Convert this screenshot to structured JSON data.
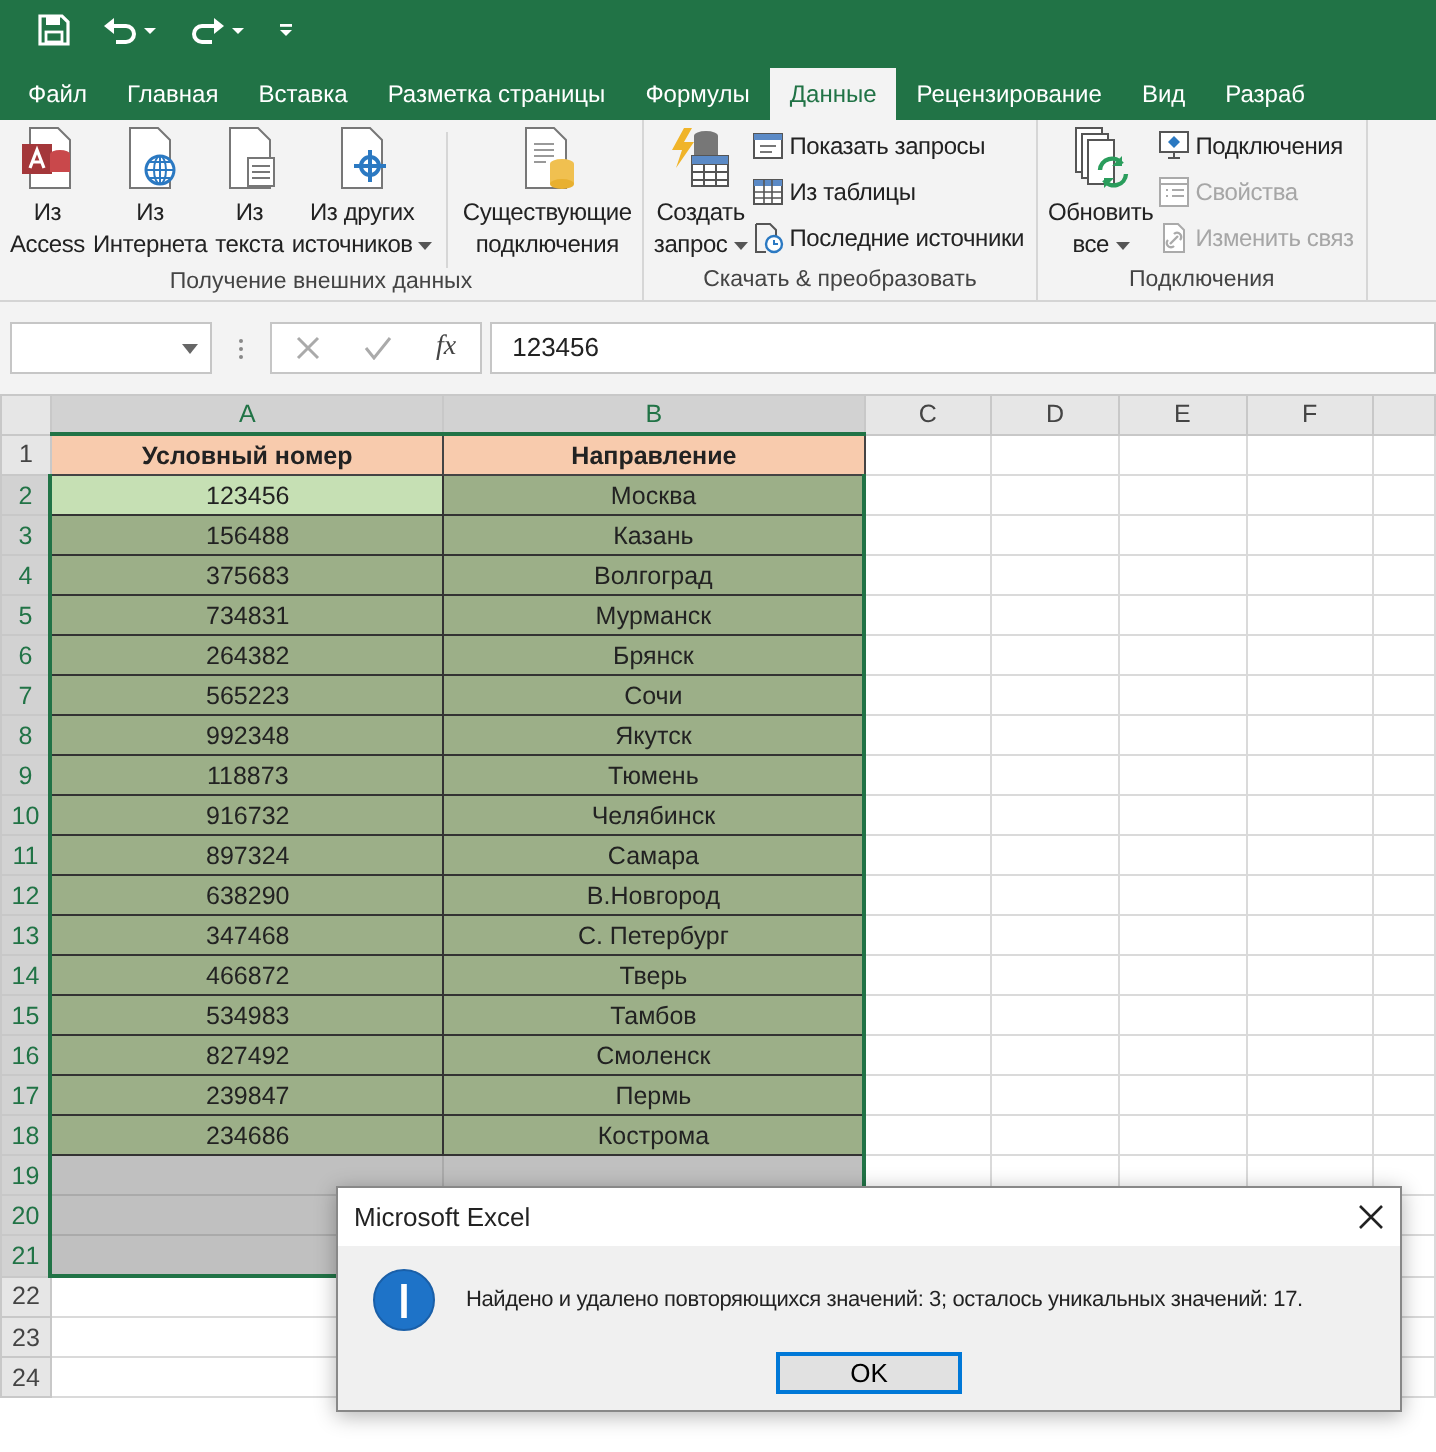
{
  "tabs": [
    {
      "label": "Файл",
      "selected": false
    },
    {
      "label": "Главная",
      "selected": false
    },
    {
      "label": "Вставка",
      "selected": false
    },
    {
      "label": "Разметка страницы",
      "selected": false
    },
    {
      "label": "Формулы",
      "selected": false
    },
    {
      "label": "Данные",
      "selected": true
    },
    {
      "label": "Рецензирование",
      "selected": false
    },
    {
      "label": "Вид",
      "selected": false
    },
    {
      "label": "Разраб",
      "selected": false
    }
  ],
  "ribbon": [
    {
      "label": "Получение внешних данных",
      "items": [
        {
          "kind": "large",
          "lines": [
            "Из",
            "Access"
          ],
          "dropdown": false,
          "disabled": false
        },
        {
          "kind": "large",
          "lines": [
            "Из",
            "Интернета"
          ],
          "dropdown": false,
          "disabled": false
        },
        {
          "kind": "large",
          "lines": [
            "Из",
            "текста"
          ],
          "dropdown": false,
          "disabled": false
        },
        {
          "kind": "large",
          "lines": [
            "Из других",
            "источников"
          ],
          "dropdown": true,
          "disabled": false
        },
        {
          "kind": "divider"
        },
        {
          "kind": "large",
          "lines": [
            "Существующие",
            "подключения"
          ],
          "dropdown": false,
          "disabled": false
        }
      ]
    },
    {
      "label": "Скачать & преобразовать",
      "items": [
        {
          "kind": "large",
          "lines": [
            "Создать",
            "запрос"
          ],
          "dropdown": true,
          "disabled": false
        },
        {
          "kind": "small",
          "lines": [
            "Показать запросы"
          ],
          "dropdown": false,
          "disabled": false
        },
        {
          "kind": "small",
          "lines": [
            "Из таблицы"
          ],
          "dropdown": false,
          "disabled": false
        },
        {
          "kind": "small",
          "lines": [
            "Последние источники"
          ],
          "dropdown": false,
          "disabled": false
        }
      ]
    },
    {
      "label": "Подключения",
      "items": [
        {
          "kind": "large",
          "lines": [
            "Обновить",
            "все"
          ],
          "dropdown": true,
          "disabled": false
        },
        {
          "kind": "small",
          "lines": [
            "Подключения"
          ],
          "dropdown": false,
          "disabled": false
        },
        {
          "kind": "small",
          "lines": [
            "Свойства"
          ],
          "dropdown": false,
          "disabled": true
        },
        {
          "kind": "small",
          "lines": [
            "Изменить связ"
          ],
          "dropdown": false,
          "disabled": true
        }
      ]
    }
  ],
  "formula_bar": {
    "fx": "fx",
    "value": "123456"
  },
  "columns": [
    "A",
    "B",
    "C",
    "D",
    "E",
    "F"
  ],
  "rows": [
    {
      "number": "1",
      "kind": "header",
      "selected": false,
      "active": false,
      "cells": [
        "Условный номер",
        "Направление"
      ]
    },
    {
      "number": "2",
      "kind": "data",
      "selected": true,
      "active": true,
      "cells": [
        "123456",
        "Москва"
      ]
    },
    {
      "number": "3",
      "kind": "data",
      "selected": true,
      "active": false,
      "cells": [
        "156488",
        "Казань"
      ]
    },
    {
      "number": "4",
      "kind": "data",
      "selected": true,
      "active": false,
      "cells": [
        "375683",
        "Волгоград"
      ]
    },
    {
      "number": "5",
      "kind": "data",
      "selected": true,
      "active": false,
      "cells": [
        "734831",
        "Мурманск"
      ]
    },
    {
      "number": "6",
      "kind": "data",
      "selected": true,
      "active": false,
      "cells": [
        "264382",
        "Брянск"
      ]
    },
    {
      "number": "7",
      "kind": "data",
      "selected": true,
      "active": false,
      "cells": [
        "565223",
        "Сочи"
      ]
    },
    {
      "number": "8",
      "kind": "data",
      "selected": true,
      "active": false,
      "cells": [
        "992348",
        "Якутск"
      ]
    },
    {
      "number": "9",
      "kind": "data",
      "selected": true,
      "active": false,
      "cells": [
        "118873",
        "Тюмень"
      ]
    },
    {
      "number": "10",
      "kind": "data",
      "selected": true,
      "active": false,
      "cells": [
        "916732",
        "Челябинск"
      ]
    },
    {
      "number": "11",
      "kind": "data",
      "selected": true,
      "active": false,
      "cells": [
        "897324",
        "Самара"
      ]
    },
    {
      "number": "12",
      "kind": "data",
      "selected": true,
      "active": false,
      "cells": [
        "638290",
        "В.Новгород"
      ]
    },
    {
      "number": "13",
      "kind": "data",
      "selected": true,
      "active": false,
      "cells": [
        "347468",
        "С. Петербург"
      ]
    },
    {
      "number": "14",
      "kind": "data",
      "selected": true,
      "active": false,
      "cells": [
        "466872",
        "Тверь"
      ]
    },
    {
      "number": "15",
      "kind": "data",
      "selected": true,
      "active": false,
      "cells": [
        "534983",
        "Тамбов"
      ]
    },
    {
      "number": "16",
      "kind": "data",
      "selected": true,
      "active": false,
      "cells": [
        "827492",
        "Смоленск"
      ]
    },
    {
      "number": "17",
      "kind": "data",
      "selected": true,
      "active": false,
      "cells": [
        "239847",
        "Пермь"
      ]
    },
    {
      "number": "18",
      "kind": "data",
      "selected": true,
      "active": false,
      "cells": [
        "234686",
        "Кострома"
      ]
    },
    {
      "number": "19",
      "kind": "empty",
      "selected": true,
      "active": false,
      "cells": []
    },
    {
      "number": "20",
      "kind": "empty",
      "selected": true,
      "active": false,
      "cells": []
    },
    {
      "number": "21",
      "kind": "empty",
      "selected": true,
      "active": false,
      "cells": []
    },
    {
      "number": "22",
      "kind": "empty",
      "selected": false,
      "active": false,
      "cells": []
    },
    {
      "number": "23",
      "kind": "empty",
      "selected": false,
      "active": false,
      "cells": []
    },
    {
      "number": "24",
      "kind": "empty",
      "selected": false,
      "active": false,
      "cells": []
    }
  ],
  "dialog": {
    "title": "Microsoft Excel",
    "message": "Найдено и удалено повторяющихся значений: 3; осталось уникальных значений: 17.",
    "button": "OK"
  }
}
